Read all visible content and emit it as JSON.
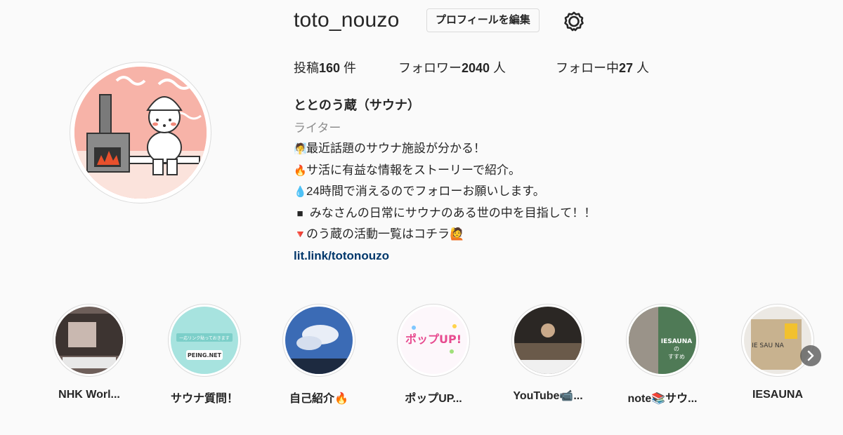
{
  "profile": {
    "username": "toto_nouzo",
    "edit_label": "プロフィールを編集",
    "settings_icon": "gear-icon"
  },
  "stats": {
    "posts_prefix": "投稿",
    "posts_count": "160",
    "posts_suffix": " 件",
    "followers_prefix": "フォロワー",
    "followers_count": "2040",
    "followers_suffix": " 人",
    "following_prefix": "フォロー中",
    "following_count": "27",
    "following_suffix": " 人"
  },
  "bio": {
    "name": "ととのう蔵（サウナ）",
    "category": "ライター",
    "lines": [
      {
        "emoji": "🧖",
        "text": "最近話題のサウナ施設が分かる！"
      },
      {
        "emoji": "🔥",
        "text": "サ活に有益な情報をストーリーで紹介。"
      },
      {
        "emoji": "💧",
        "text": "24時間で消えるのでフォローお願いします。"
      },
      {
        "emoji": "■",
        "text": " みなさんの日常にサウナのある世の中を目指して！！"
      },
      {
        "emoji": "🔻",
        "text": "のう蔵の活動一覧はコチラ🙋"
      }
    ],
    "link": "lit.link/totonouzo"
  },
  "highlights": [
    {
      "label": "NHK Worl..."
    },
    {
      "label": "サウナ質問！"
    },
    {
      "label": "自己紹介🔥"
    },
    {
      "label": "ポップUP..."
    },
    {
      "label": "YouTube📹..."
    },
    {
      "label": "note📚サウ..."
    },
    {
      "label": "IESAUNA"
    }
  ],
  "highlight_texts": {
    "h2_banner": "一応リンク貼っておきます",
    "h2_peing": "PEING.NET",
    "h4_title": "ポップUP!",
    "h6_title": "IESAUNA",
    "h6_sub": "の",
    "h6_sub2": "すすめ",
    "h7_text": "IE SAU NA"
  },
  "colors": {
    "link": "#00376b",
    "avatar_bg": "#f7b3a8",
    "muted": "#8e8e8e"
  }
}
